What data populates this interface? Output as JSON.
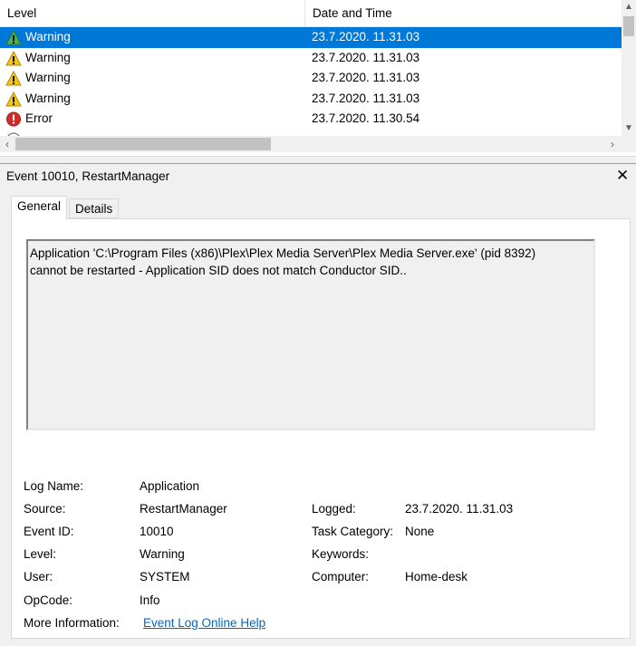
{
  "list": {
    "columns": {
      "level": "Level",
      "date_time": "Date and Time"
    },
    "rows": [
      {
        "level": "Warning",
        "date_time": "23.7.2020. 11.31.03",
        "icon": "warning-icon",
        "selected": true
      },
      {
        "level": "Warning",
        "date_time": "23.7.2020. 11.31.03",
        "icon": "warning-icon",
        "selected": false
      },
      {
        "level": "Warning",
        "date_time": "23.7.2020. 11.31.03",
        "icon": "warning-icon",
        "selected": false
      },
      {
        "level": "Warning",
        "date_time": "23.7.2020. 11.31.03",
        "icon": "warning-icon",
        "selected": false
      },
      {
        "level": "Error",
        "date_time": "23.7.2020. 11.30.54",
        "icon": "error-icon",
        "selected": false
      }
    ]
  },
  "detail": {
    "title": "Event 10010, RestartManager",
    "close_glyph": "✕",
    "tabs": {
      "general": "General",
      "details": "Details"
    },
    "description": "Application 'C:\\Program Files (x86)\\Plex\\Plex Media Server\\Plex Media Server.exe' (pid 8392)\ncannot be restarted - Application SID does not match Conductor SID..",
    "fields": {
      "log_name": {
        "label": "Log Name:",
        "value": "Application"
      },
      "source": {
        "label": "Source:",
        "value": "RestartManager"
      },
      "logged": {
        "label": "Logged:",
        "value": "23.7.2020. 11.31.03"
      },
      "event_id": {
        "label": "Event ID:",
        "value": "10010"
      },
      "task_category": {
        "label": "Task Category:",
        "value": "None"
      },
      "level": {
        "label": "Level:",
        "value": "Warning"
      },
      "keywords": {
        "label": "Keywords:",
        "value": ""
      },
      "user": {
        "label": "User:",
        "value": "SYSTEM"
      },
      "computer": {
        "label": "Computer:",
        "value": "Home-desk"
      },
      "opcode": {
        "label": "OpCode:",
        "value": "Info"
      },
      "more_information": {
        "label": "More Information:",
        "value": "Event Log Online Help"
      }
    }
  },
  "colors": {
    "selection": "#0078d7",
    "link": "#0066cc",
    "warning": "#f5c518",
    "error": "#d42a2a"
  }
}
